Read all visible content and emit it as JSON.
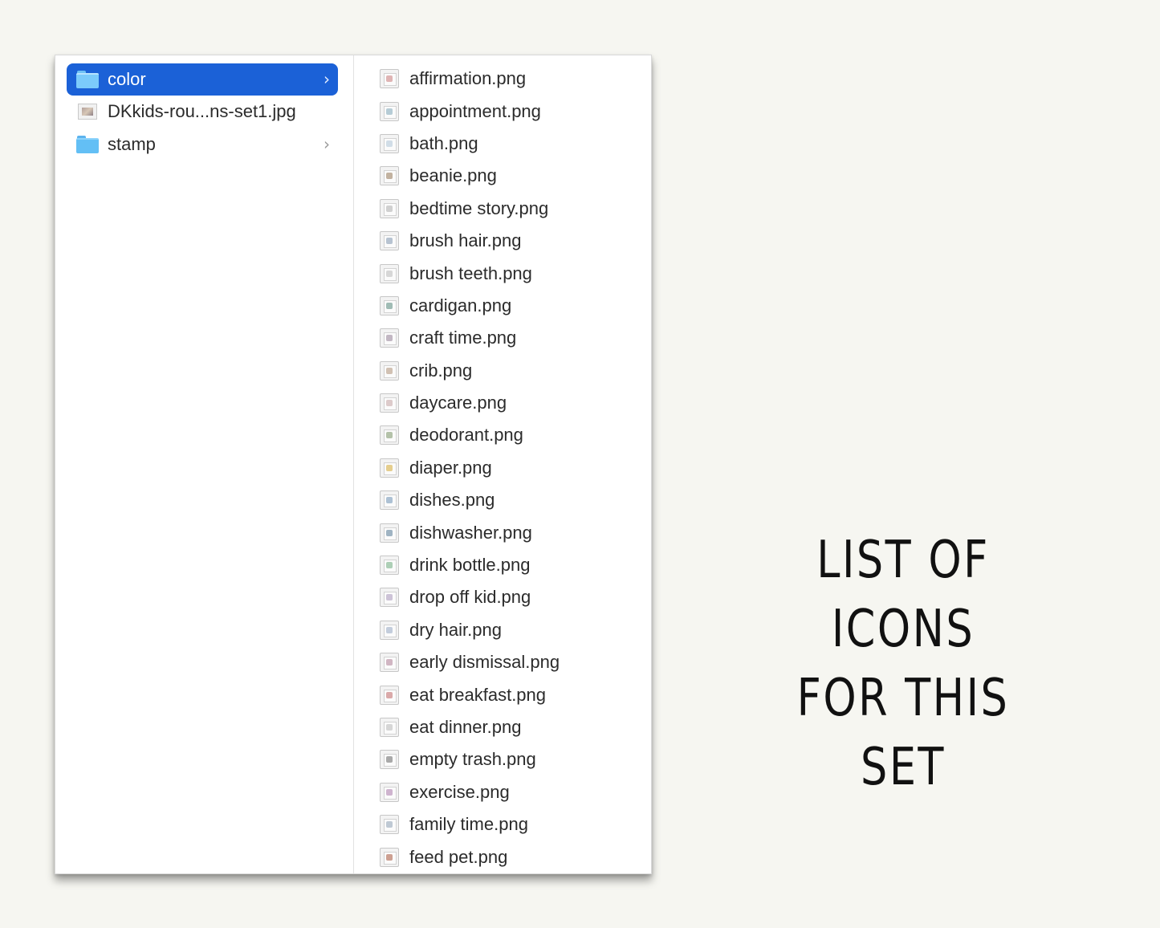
{
  "left_column": {
    "items": [
      {
        "label": "color",
        "kind": "folder",
        "selected": true,
        "chevron": "›",
        "icon": "folder-icon"
      },
      {
        "label": "DKkids-rou...ns-set1.jpg",
        "kind": "image",
        "selected": false,
        "chevron": "",
        "icon": "image-thumbnail-icon"
      },
      {
        "label": "stamp",
        "kind": "folder",
        "selected": false,
        "chevron": "›",
        "icon": "folder-icon"
      }
    ]
  },
  "right_column": {
    "files": [
      "affirmation.png",
      "appointment.png",
      "bath.png",
      "beanie.png",
      "bedtime story.png",
      "brush hair.png",
      "brush teeth.png",
      "cardigan.png",
      "craft time.png",
      "crib.png",
      "daycare.png",
      "deodorant.png",
      "diaper.png",
      "dishes.png",
      "dishwasher.png",
      "drink bottle.png",
      "drop off kid.png",
      "dry hair.png",
      "early dismissal.png",
      "eat breakfast.png",
      "eat dinner.png",
      "empty trash.png",
      "exercise.png",
      "family time.png",
      "feed pet.png"
    ]
  },
  "caption": {
    "line1": "LIST OF ICONS",
    "line2": "FOR THIS",
    "line3": "SET"
  },
  "colors": {
    "selection": "#1b61d7",
    "folder": "#63bff5",
    "background": "#f6f6f1",
    "text": "#2b2b2b"
  }
}
